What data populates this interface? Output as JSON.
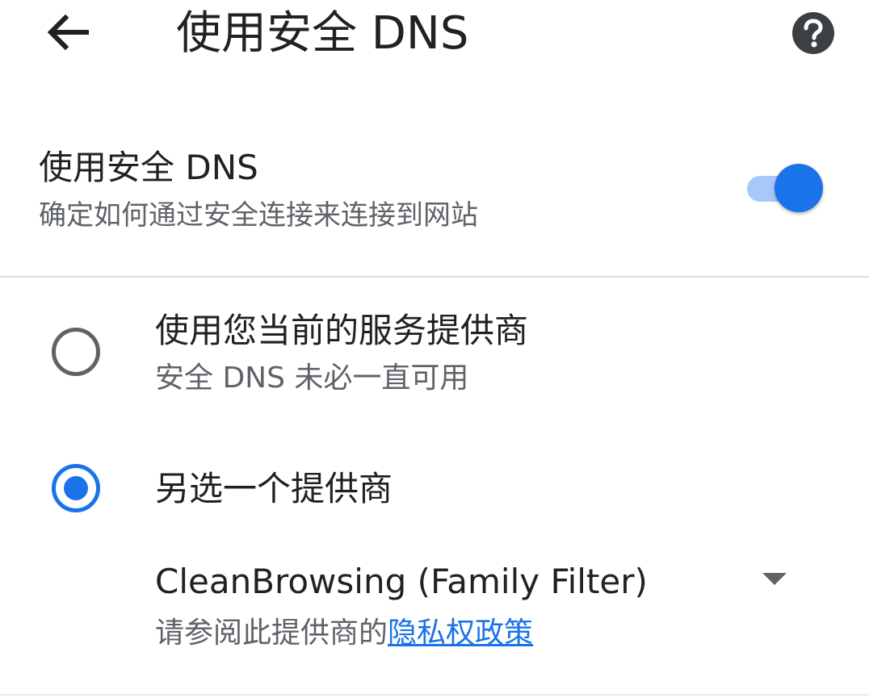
{
  "header": {
    "title": "使用安全 DNS",
    "back_icon": "arrow-left-icon",
    "help_icon": "help-circle-icon"
  },
  "secure_dns_toggle": {
    "title": "使用安全 DNS",
    "subtitle": "确定如何通过安全连接来连接到网站",
    "enabled": true
  },
  "options": [
    {
      "label": "使用您当前的服务提供商",
      "description": "安全 DNS 未必一直可用",
      "selected": false
    },
    {
      "label": "另选一个提供商",
      "selected": true
    }
  ],
  "provider": {
    "selected_value": "CleanBrowsing (Family Filter)",
    "privacy_prefix": "请参阅此提供商的",
    "privacy_link": "隐私权政策"
  },
  "colors": {
    "accent": "#1a73e8",
    "accent_light": "#a8c7fa",
    "text_primary": "#202124",
    "text_secondary": "#5f6368"
  }
}
